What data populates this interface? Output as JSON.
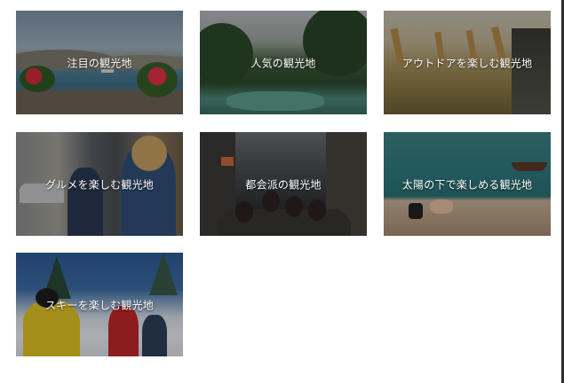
{
  "tiles": [
    {
      "label": "注目の観光地"
    },
    {
      "label": "人気の観光地"
    },
    {
      "label": "アウトドアを楽しむ観光地"
    },
    {
      "label": "グルメを楽しむ観光地"
    },
    {
      "label": "都会派の観光地"
    },
    {
      "label": "太陽の下で楽しめる観光地"
    },
    {
      "label": "スキーを楽しむ観光地"
    }
  ],
  "colors": {
    "background": "#ffffff",
    "label_text": "#ffffff",
    "overlay": "rgba(0,0,0,0.28)"
  }
}
